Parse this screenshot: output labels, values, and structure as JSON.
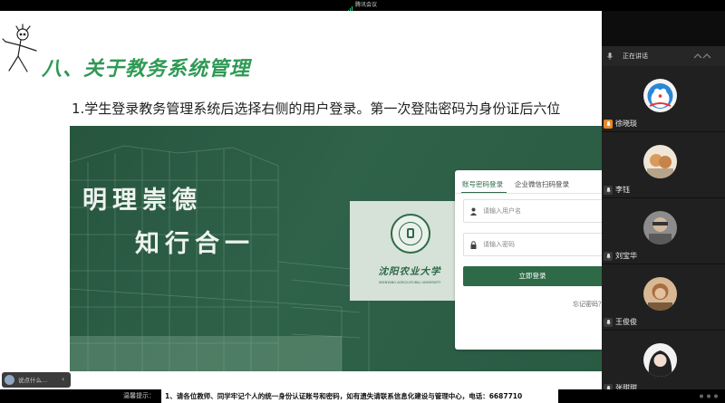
{
  "app": {
    "title": "腾讯会议"
  },
  "slide": {
    "heading": "八、关于教务系统管理",
    "subtitle": "1.学生登录教务管理系统后选择右侧的用户登录。第一次登陆密码为身份证后六位"
  },
  "portal": {
    "motto_line1": "明理崇德",
    "motto_line2": "知行合一",
    "school_name": "沈阳农业大学",
    "school_en": "SHENYANG AGRICULTURAL UNIVERSITY",
    "tabs": [
      {
        "label": "账号密码登录"
      },
      {
        "label": "企业微信扫码登录"
      }
    ],
    "username_placeholder": "请输入用户名",
    "password_placeholder": "请输入密码",
    "login_button": "立即登录",
    "forgot_link": "忘记密码？"
  },
  "panel": {
    "speaking_label": "正在讲话",
    "participants": [
      {
        "name": "徐晓琰",
        "mic_active": true
      },
      {
        "name": "李钰",
        "mic_active": false
      },
      {
        "name": "刘宝华",
        "mic_active": false
      },
      {
        "name": "王俊俊",
        "mic_active": false
      },
      {
        "name": "张甜甜",
        "mic_active": false
      }
    ]
  },
  "chat": {
    "placeholder": "说点什么..."
  },
  "notice": {
    "label": "温馨提示：",
    "text": "1、请各位教师、同学牢记个人的统一身份认证账号和密码，如有遗失请联系信息化建设与管理中心，电话：6687710"
  },
  "colors": {
    "slide_green": "#2f9955",
    "portal_green": "#2e6a47",
    "mic_active": "#e6862a"
  }
}
